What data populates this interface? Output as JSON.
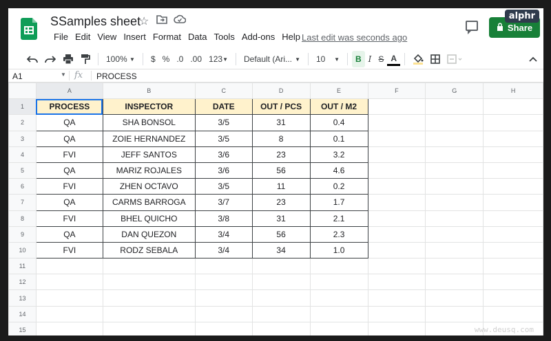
{
  "app": {
    "title": "SSamples sheet",
    "menu": [
      "File",
      "Edit",
      "View",
      "Insert",
      "Format",
      "Data",
      "Tools",
      "Add-ons",
      "Help"
    ],
    "last_edit": "Last edit was seconds ago",
    "share_label": "Share",
    "brand_color": "#188038"
  },
  "toolbar": {
    "zoom": "100%",
    "currency": "$",
    "percent": "%",
    "decrease_decimals": ".0",
    "increase_decimals": ".00",
    "more_formats": "123",
    "font": "Default (Ari...",
    "font_size": "10",
    "bold": "B",
    "italic": "I",
    "strikethrough": "S",
    "text_color": "A"
  },
  "formula_bar": {
    "cell_ref": "A1",
    "fx": "fx",
    "content": "PROCESS"
  },
  "sheet": {
    "columns": [
      "A",
      "B",
      "C",
      "D",
      "E",
      "F",
      "G",
      "H"
    ],
    "row_numbers": [
      "1",
      "2",
      "3",
      "4",
      "5",
      "6",
      "7",
      "8",
      "9",
      "10",
      "11",
      "12",
      "13",
      "14",
      "15"
    ],
    "header": [
      "PROCESS",
      "INSPECTOR",
      "DATE",
      "OUT / PCS",
      "OUT / M2"
    ],
    "header_fill": "#fff2cc",
    "rows": [
      [
        "QA",
        "SHA BONSOL",
        "3/5",
        "31",
        "0.4"
      ],
      [
        "QA",
        "ZOIE HERNANDEZ",
        "3/5",
        "8",
        "0.1"
      ],
      [
        "FVI",
        "JEFF SANTOS",
        "3/6",
        "23",
        "3.2"
      ],
      [
        "QA",
        "MARIZ ROJALES",
        "3/6",
        "56",
        "4.6"
      ],
      [
        "FVI",
        "ZHEN OCTAVO",
        "3/5",
        "11",
        "0.2"
      ],
      [
        "QA",
        "CARMS BARROGA",
        "3/7",
        "23",
        "1.7"
      ],
      [
        "FVI",
        "BHEL QUICHO",
        "3/8",
        "31",
        "2.1"
      ],
      [
        "QA",
        "DAN QUEZON",
        "3/4",
        "56",
        "2.3"
      ],
      [
        "FVI",
        "RODZ SEBALA",
        "3/4",
        "34",
        "1.0"
      ]
    ]
  },
  "watermarks": {
    "brand": "alphr",
    "site": "www.deusq.com"
  }
}
